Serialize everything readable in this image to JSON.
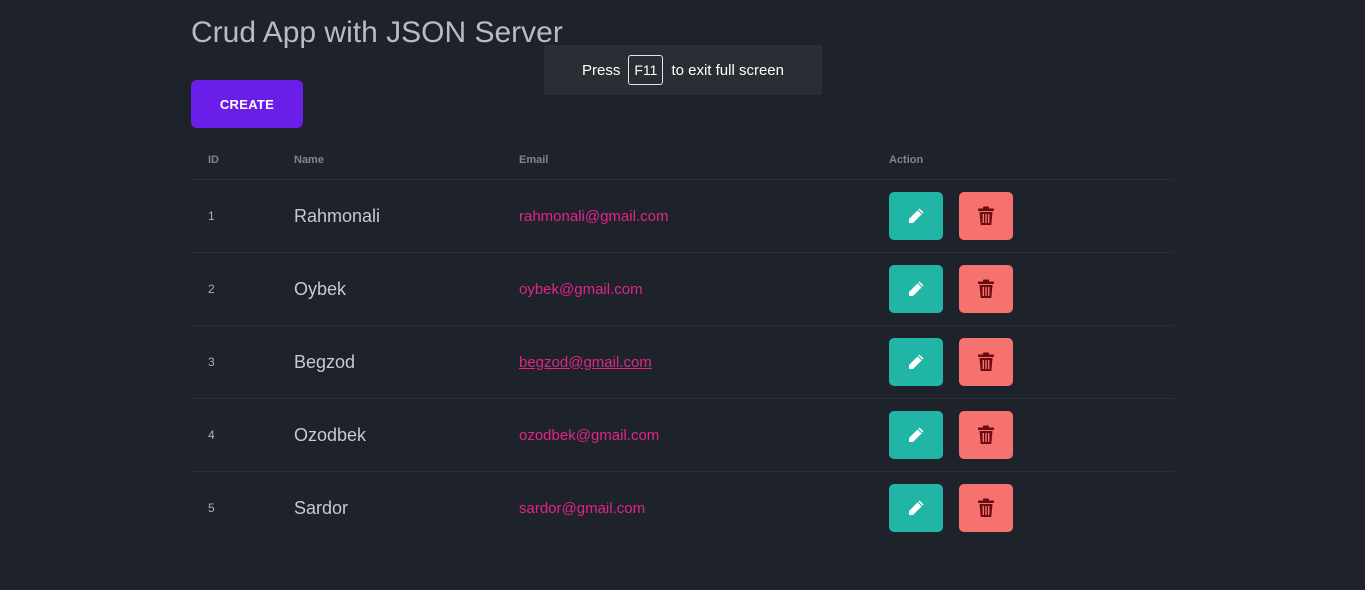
{
  "header": {
    "title": "Crud App with JSON Server",
    "create_label": "CREATE"
  },
  "table": {
    "columns": [
      "ID",
      "Name",
      "Email",
      "Action"
    ],
    "rows": [
      {
        "id": "1",
        "name": "Rahmonali",
        "email": "rahmonali@gmail.com"
      },
      {
        "id": "2",
        "name": "Oybek",
        "email": "oybek@gmail.com"
      },
      {
        "id": "3",
        "name": "Begzod",
        "email": "begzod@gmail.com"
      },
      {
        "id": "4",
        "name": "Ozodbek",
        "email": "ozodbek@gmail.com"
      },
      {
        "id": "5",
        "name": "Sardor",
        "email": "sardor@gmail.com"
      }
    ],
    "hovered_email_row": 2
  },
  "fullscreen_toast": {
    "before": "Press",
    "key": "F11",
    "after": "to exit full screen"
  },
  "icons": {
    "edit": "pencil-icon",
    "delete": "trash-icon"
  },
  "colors": {
    "background": "#1e222a",
    "create_button": "#6a1ee8",
    "edit_button": "#21b5a6",
    "delete_button": "#f6726f",
    "email_text": "#e0258a"
  }
}
